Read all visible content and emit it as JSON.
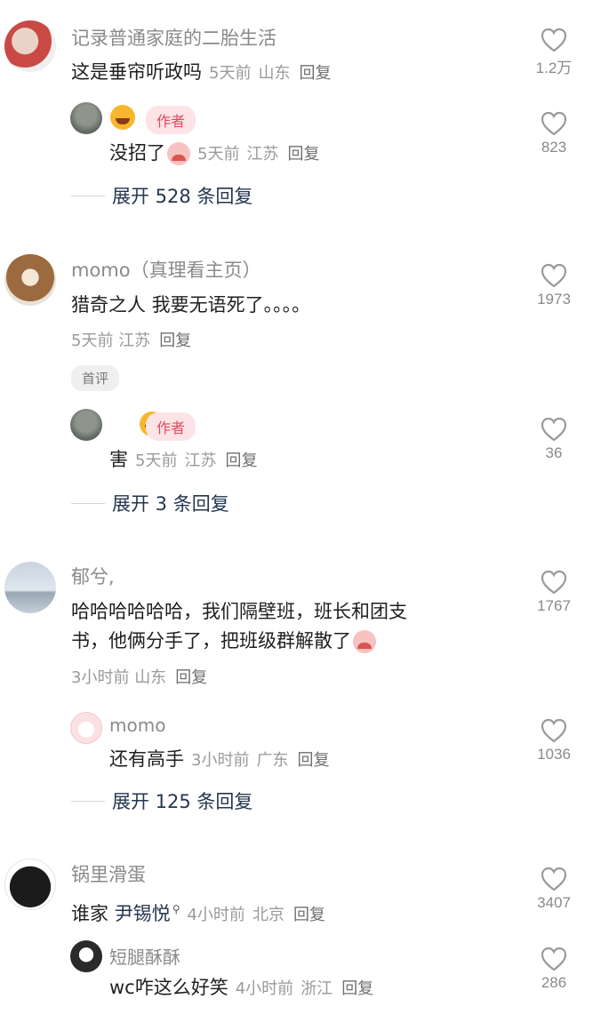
{
  "comments": [
    {
      "user": "记录普通家庭的二胎生活",
      "text": "这是垂帘听政吗",
      "time": "5天前",
      "location": "山东",
      "reply_label": "回复",
      "likes": "1.2万",
      "replies": [
        {
          "badge": "作者",
          "text": "没招了",
          "time": "5天前",
          "location": "江苏",
          "reply_label": "回复",
          "likes": "823"
        }
      ],
      "expand": "展开 528 条回复"
    },
    {
      "user": "momo（真理看主页）",
      "text": "猎奇之人 我要无语死了。。。。",
      "time": "5天前",
      "location": "江苏",
      "reply_label": "回复",
      "likes": "1973",
      "tag": "首评",
      "replies": [
        {
          "badge": "作者",
          "text": "害",
          "time": "5天前",
          "location": "江苏",
          "reply_label": "回复",
          "likes": "36"
        }
      ],
      "expand": "展开 3 条回复"
    },
    {
      "user": "郁兮,",
      "text_line1": "哈哈哈哈哈哈，我们隔壁班，班长和团支",
      "text_line2": "书，他俩分手了，把班级群解散了",
      "time": "3小时前",
      "location": "山东",
      "reply_label": "回复",
      "likes": "1767",
      "replies": [
        {
          "user": "momo",
          "text": "还有高手",
          "time": "3小时前",
          "location": "广东",
          "reply_label": "回复",
          "likes": "1036"
        }
      ],
      "expand": "展开 125 条回复"
    },
    {
      "user": "锅里滑蛋",
      "text_prefix": "谁家 ",
      "mention": "尹锡悦",
      "time": "4小时前",
      "location": "北京",
      "reply_label": "回复",
      "likes": "3407",
      "replies": [
        {
          "user": "短腿酥酥",
          "text": "wc咋这么好笑",
          "time": "4小时前",
          "location": "浙江",
          "reply_label": "回复",
          "likes": "286"
        }
      ]
    }
  ],
  "icons": {
    "like": "heart-outline-icon",
    "laugh": "rofl-emoji-icon",
    "cry": "crying-emoji-icon",
    "search": "search-icon"
  },
  "colors": {
    "author_badge_bg": "#fde3e6",
    "author_badge_text": "#e24a5c",
    "expand_text": "#24364f"
  }
}
